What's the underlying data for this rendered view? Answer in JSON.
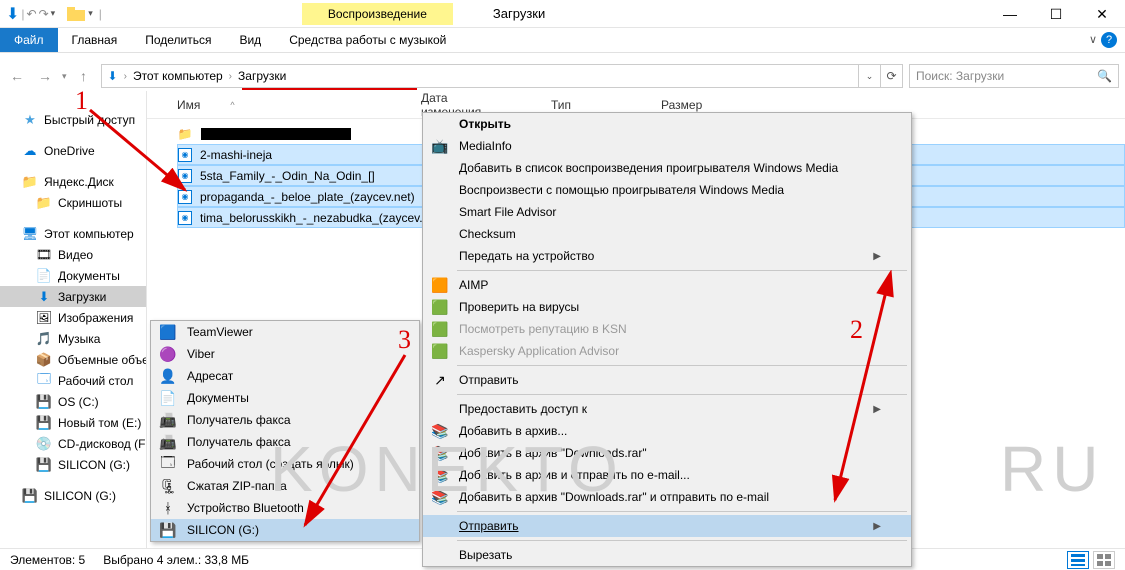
{
  "titlebar": {
    "tools_tab": "Воспроизведение",
    "title": "Загрузки"
  },
  "window_controls": {
    "min": "—",
    "max": "☐",
    "close": "✕"
  },
  "ribbon": {
    "file": "Файл",
    "home": "Главная",
    "share": "Поделиться",
    "view": "Вид",
    "music_tools": "Средства работы с музыкой"
  },
  "breadcrumb": {
    "pc": "Этот компьютер",
    "downloads": "Загрузки"
  },
  "search": {
    "placeholder": "Поиск: Загрузки"
  },
  "columns": {
    "name": "Имя",
    "date": "Дата изменения",
    "type": "Тип",
    "size": "Размер"
  },
  "sidebar": {
    "quick": "Быстрый доступ",
    "onedrive": "OneDrive",
    "yadisk": "Яндекс.Диск",
    "screenshots": "Скриншоты",
    "pc": "Этот компьютер",
    "video": "Видео",
    "documents": "Документы",
    "downloads": "Загрузки",
    "pictures": "Изображения",
    "music": "Музыка",
    "3d": "Объемные объекты",
    "desktop": "Рабочий стол",
    "os": "OS (C:)",
    "newvol": "Новый том (E:)",
    "cd": "CD-дисковод (F:)",
    "silicon": "SILICON (G:)",
    "silicon2": "SILICON (G:)"
  },
  "files": [
    {
      "name": "███████████████",
      "redact": true
    },
    {
      "name": "2-mashi-ineja"
    },
    {
      "name": "5sta_Family_-_Odin_Na_Odin_[]"
    },
    {
      "name": "propaganda_-_beloe_plate_(zaycev.net)"
    },
    {
      "name": "tima_belorusskikh_-_nezabudka_(zaycev..."
    }
  ],
  "submenu": [
    {
      "label": "TeamViewer",
      "icon": "tv"
    },
    {
      "label": "Viber",
      "icon": "viber"
    },
    {
      "label": "Адресат",
      "icon": "user"
    },
    {
      "label": "Документы",
      "icon": "docs"
    },
    {
      "label": "Получатель факса",
      "icon": "fax"
    },
    {
      "label": "Получатель факса",
      "icon": "fax"
    },
    {
      "label": "Рабочий стол (создать ярлык)",
      "icon": "desktop"
    },
    {
      "label": "Сжатая ZIP-папка",
      "icon": "zip"
    },
    {
      "label": "Устройство Bluetooth",
      "icon": "bt"
    },
    {
      "label": "SILICON (G:)",
      "icon": "drive",
      "sel": true
    }
  ],
  "context": [
    {
      "label": "Открыть",
      "bold": true
    },
    {
      "label": "MediaInfo",
      "icon": "mi"
    },
    {
      "label": "Добавить в список воспроизведения проигрывателя Windows Media"
    },
    {
      "label": "Воспроизвести с помощью проигрывателя Windows Media"
    },
    {
      "label": "Smart File Advisor"
    },
    {
      "label": "Checksum"
    },
    {
      "label": "Передать на устройство",
      "sub": true
    },
    {
      "hr": true
    },
    {
      "label": "AIMP",
      "icon": "aimp"
    },
    {
      "label": "Проверить на вирусы",
      "icon": "kasp"
    },
    {
      "label": "Посмотреть репутацию в KSN",
      "icon": "kasp",
      "dis": true
    },
    {
      "label": "Kaspersky Application Advisor",
      "icon": "kasp",
      "dis": true
    },
    {
      "hr": true
    },
    {
      "label": "Отправить",
      "icon": "share"
    },
    {
      "hr": true
    },
    {
      "label": "Предоставить доступ к",
      "sub": true
    },
    {
      "label": "Добавить в архив...",
      "icon": "rar"
    },
    {
      "label": "Добавить в архив \"Downloads.rar\"",
      "icon": "rar"
    },
    {
      "label": "Добавить в архив и отправить по e-mail...",
      "icon": "rar"
    },
    {
      "label": "Добавить в архив \"Downloads.rar\" и отправить по e-mail",
      "icon": "rar"
    },
    {
      "hr": true
    },
    {
      "label": "Отправить",
      "under": true,
      "sub": true,
      "sel": true
    },
    {
      "hr": true
    },
    {
      "label": "Вырезать"
    }
  ],
  "status": {
    "count": "Элементов: 5",
    "sel": "Выбрано 4 элем.: 33,8 МБ"
  },
  "annotations": {
    "a1": "1",
    "a2": "2",
    "a3": "3"
  },
  "watermark": {
    "left": "KONEKTO",
    "right": "RU"
  },
  "icons": {
    "down": "⬇",
    "undo": "↶",
    "redo": "↷",
    "sep": "|",
    "back": "←",
    "fwd": "→",
    "up": "↑",
    "refresh": "⟳",
    "search": "🔍",
    "star": "★",
    "cloud": "☁",
    "folder": "📁",
    "monitor": "🖥",
    "film": "🎞",
    "doc": "📄",
    "img": "🖼",
    "music": "🎵",
    "cube": "📦",
    "desk": "🗔",
    "disk": "💾",
    "cd": "💿",
    "chev": "›",
    "morev": "∨",
    "morec": "^"
  }
}
